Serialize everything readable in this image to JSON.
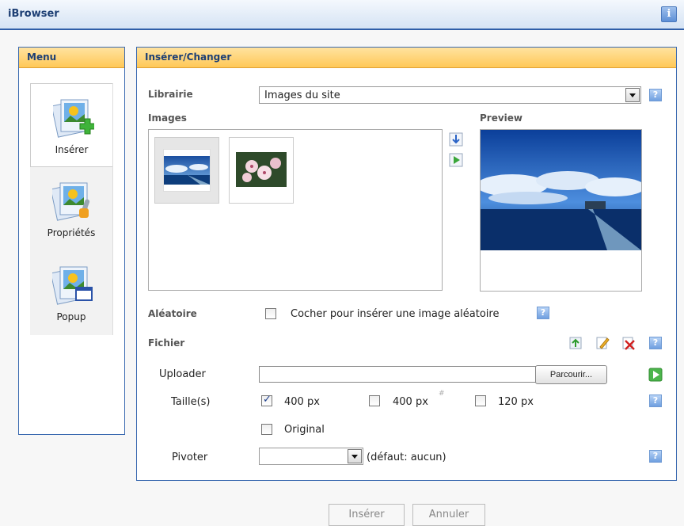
{
  "window": {
    "title": "iBrowser",
    "info_icon": "i"
  },
  "menu": {
    "title": "Menu",
    "items": [
      {
        "label": "Insérer",
        "icon": "insert-image-icon",
        "active": true
      },
      {
        "label": "Propriétés",
        "icon": "properties-image-icon",
        "active": false
      },
      {
        "label": "Popup",
        "icon": "popup-image-icon",
        "active": false
      }
    ]
  },
  "main": {
    "title": "Insérer/Changer",
    "library": {
      "label": "Librairie",
      "value": "Images du site"
    },
    "images": {
      "label": "Images",
      "thumbnails": [
        "pier-sky-thumbnail",
        "flowers-thumbnail"
      ]
    },
    "preview": {
      "label": "Preview"
    },
    "random": {
      "label": "Aléatoire",
      "checkbox_text": "Cocher pour insérer une image aléatoire",
      "checked": false
    },
    "file": {
      "label": "Fichier"
    },
    "uploader": {
      "label": "Uploader",
      "browse_label": "Parcourir..."
    },
    "sizes": {
      "label": "Taille(s)",
      "options": [
        {
          "text": "400 px",
          "checked": true
        },
        {
          "text": "400 px",
          "checked": false,
          "watermark": true
        },
        {
          "text": "120 px",
          "checked": false
        }
      ],
      "original": {
        "text": "Original",
        "checked": false
      }
    },
    "rotate": {
      "label": "Pivoter",
      "value": "",
      "default_text": "(défaut: aucun)"
    },
    "help": "?"
  },
  "footer": {
    "insert_label": "Insérer",
    "cancel_label": "Annuler"
  },
  "colors": {
    "accent": "#2f5ea8",
    "header": "#ffc857",
    "help": "#6f9fe0"
  }
}
